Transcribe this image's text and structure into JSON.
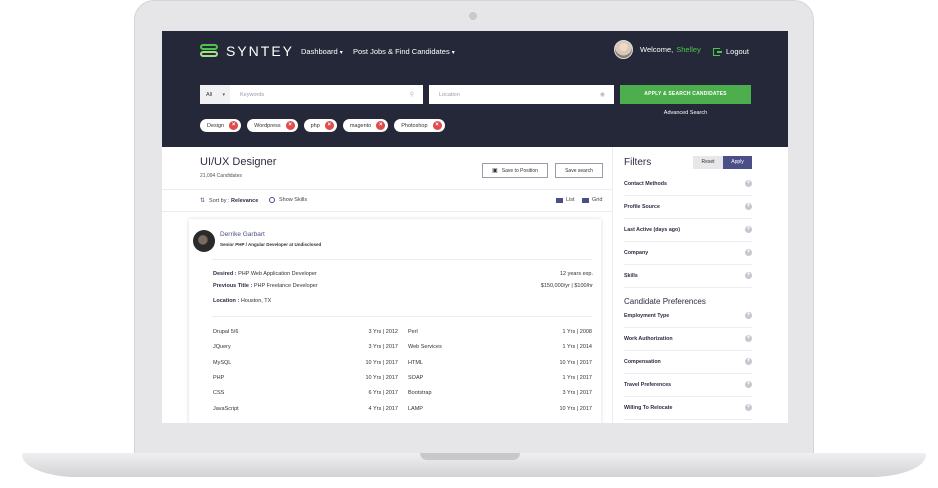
{
  "brand": {
    "name": "SYNTEY",
    "accent": "#4cc34a",
    "header_bg": "#252838",
    "primary": "#4a4f87"
  },
  "nav": [
    {
      "label": "Dashboard"
    },
    {
      "label": "Post Jobs & Find Candidates"
    }
  ],
  "user": {
    "welcome": "Welcome,",
    "name": "Shelley",
    "logout": "Logout"
  },
  "search": {
    "scope": "All",
    "keyword_placeholder": "Keywords",
    "location_placeholder": "Location",
    "apply_label": "APPLY & SEARCH CANDIDATES",
    "advanced_label": "Advanced Search"
  },
  "tags": [
    "Design",
    "Wordpress",
    "php",
    "magento",
    "Photoshop"
  ],
  "results": {
    "title": "UI/UX Designer",
    "count": "21,094 Candidates",
    "save_position": "Save to Position",
    "save_search": "Save search",
    "sort_prefix": "Sort by :",
    "sort_value": "Relevance",
    "show_skills": "Show Skills",
    "view_list": "List",
    "view_grid": "Grid"
  },
  "candidate": {
    "name": "Derrike Garbart",
    "subtitle": "Senior PHP / Angular Developer at Undisclosed",
    "desired_label": "Desired :",
    "desired_value": "PHP Web Application Developer",
    "previous_label": "Previous Title :",
    "previous_value": "PHP Freelance Developer",
    "location_label": "Location :",
    "location_value": "Houston, TX",
    "experience": "12 years exp.",
    "salary": "$150,000/yr | $100/hr",
    "skills_left": [
      {
        "name": "Drupal 5/6",
        "value": "3 Yrs | 2012"
      },
      {
        "name": "JQuery",
        "value": "3 Yrs | 2017"
      },
      {
        "name": "MySQL",
        "value": "10 Yrs | 2017"
      },
      {
        "name": "PHP",
        "value": "10 Yrs | 2017"
      },
      {
        "name": "CSS",
        "value": "6 Yrs | 2017"
      },
      {
        "name": "JavaScript",
        "value": "4 Yrs | 2017"
      }
    ],
    "skills_right": [
      {
        "name": "Perl",
        "value": "1 Yrs | 2008"
      },
      {
        "name": "Web Services",
        "value": "1 Yrs | 2014"
      },
      {
        "name": "HTML",
        "value": "10 Yrs | 2017"
      },
      {
        "name": "SOAP",
        "value": "1 Yrs | 2017"
      },
      {
        "name": "Bootstrap",
        "value": "3 Yrs | 2017"
      },
      {
        "name": "LAMP",
        "value": "10 Yrs | 2017"
      }
    ]
  },
  "filters": {
    "title": "Filters",
    "reset": "Reset",
    "apply": "Apply",
    "group1": [
      "Contact Methods",
      "Profile Source",
      "Last Active (days ago)",
      "Company",
      "Skills"
    ],
    "preferences_title": "Candidate Preferences",
    "group2": [
      "Employment Type",
      "Work Authorization",
      "Compensation",
      "Travel Preferences",
      "Willing To Relocate"
    ]
  }
}
